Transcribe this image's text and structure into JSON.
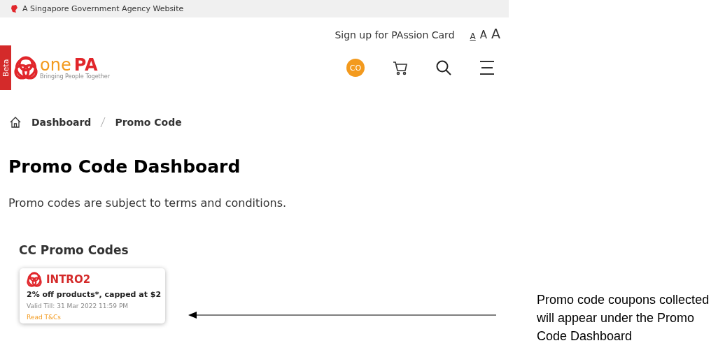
{
  "gov_bar": {
    "text": "A Singapore Government Agency Website"
  },
  "top_links": {
    "signup": "Sign up for PAssion Card",
    "font_sizes": [
      {
        "label": "A",
        "selected": true
      },
      {
        "label": "A",
        "selected": false
      },
      {
        "label": "A",
        "selected": false
      }
    ]
  },
  "header": {
    "beta_tab": "Beta",
    "logo": {
      "one": "one",
      "pa": "PA",
      "tagline": "Bringing People Together"
    },
    "avatar": "CO"
  },
  "breadcrumb": [
    "Dashboard",
    "Promo Code"
  ],
  "title": "Promo Code Dashboard",
  "intro": "Promo codes are subject to terms and conditions.",
  "section": {
    "heading": "CC Promo Codes",
    "coupons": [
      {
        "code": "INTRO2",
        "description": "2% off products*, capped at $2",
        "valid": "Valid Till: 31 Mar 2022 11:59 PM",
        "link": "Read T&Cs"
      }
    ]
  },
  "annotation": {
    "text": "Promo code coupons collected will appear under the Promo Code Dashboard"
  }
}
